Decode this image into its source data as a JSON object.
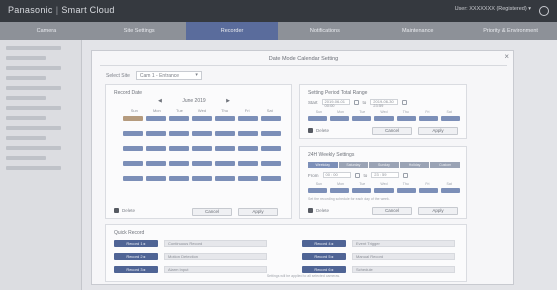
{
  "header": {
    "brand": "Panasonic",
    "product": "Smart Cloud",
    "user": "User: XXXXXXX (Registered) ▾"
  },
  "nav": {
    "tabs": [
      {
        "label": "Camera",
        "active": false
      },
      {
        "label": "Site Settings",
        "active": false
      },
      {
        "label": "Recorder",
        "active": true
      },
      {
        "label": "Notifications",
        "active": false
      },
      {
        "label": "Maintenance",
        "active": false
      },
      {
        "label": "Priority & Environment",
        "active": false
      }
    ]
  },
  "modal": {
    "title": "Date Mode Calendar Setting",
    "close_icon": "close-icon",
    "select_label": "Select Site",
    "select_value": "Cam 1 - Entrance",
    "record_date": {
      "title": "Record Date",
      "month": "June 2019",
      "prev": "◀",
      "next": "▶",
      "weekdays": [
        "Sun",
        "Mon",
        "Tue",
        "Wed",
        "Thu",
        "Fri",
        "Sat"
      ],
      "rows": 5,
      "selected_cell": 0,
      "delete_label": "Delete",
      "cancel_label": "Cancel",
      "apply_label": "Apply"
    },
    "period": {
      "title": "Setting Period Total Range",
      "start_label": "Start",
      "start_value": "2019-06-01 00:00",
      "mid_icon": "calendar-icon",
      "end_label": "to",
      "end_value": "2019-06-30 23:59",
      "weekdays": [
        "Sun",
        "Mon",
        "Tue",
        "Wed",
        "Thu",
        "Fri",
        "Sat"
      ],
      "delete_label": "Delete",
      "cancel_label": "Cancel",
      "apply_label": "Apply"
    },
    "weekly": {
      "title": "24H Weekly Settings",
      "tabs": [
        "Weekday",
        "Saturday",
        "Sunday",
        "Holiday",
        "Custom"
      ],
      "active_tab": 0,
      "from_label": "From",
      "from_value": "00 : 00",
      "to_label": "to",
      "to_value": "23 : 59",
      "weekdays": [
        "Sun",
        "Mon",
        "Tue",
        "Wed",
        "Thu",
        "Fri",
        "Sat"
      ],
      "note": "Set the recording schedule for each day of the week.",
      "delete_label": "Delete",
      "cancel_label": "Cancel",
      "apply_label": "Apply"
    },
    "quick": {
      "title": "Quick Record",
      "left": [
        {
          "button": "Record 1 ▸",
          "field": "Continuous Record"
        },
        {
          "button": "Record 2 ▸",
          "field": "Motion Detection"
        },
        {
          "button": "Record 3 ▸",
          "field": "Alarm Input"
        }
      ],
      "right": [
        {
          "button": "Record 4 ▸",
          "field": "Event Trigger"
        },
        {
          "button": "Record 5 ▸",
          "field": "Manual Record"
        },
        {
          "button": "Record 6 ▸",
          "field": "Schedule"
        }
      ],
      "footer": "Settings will be applied to all selected cameras."
    }
  }
}
